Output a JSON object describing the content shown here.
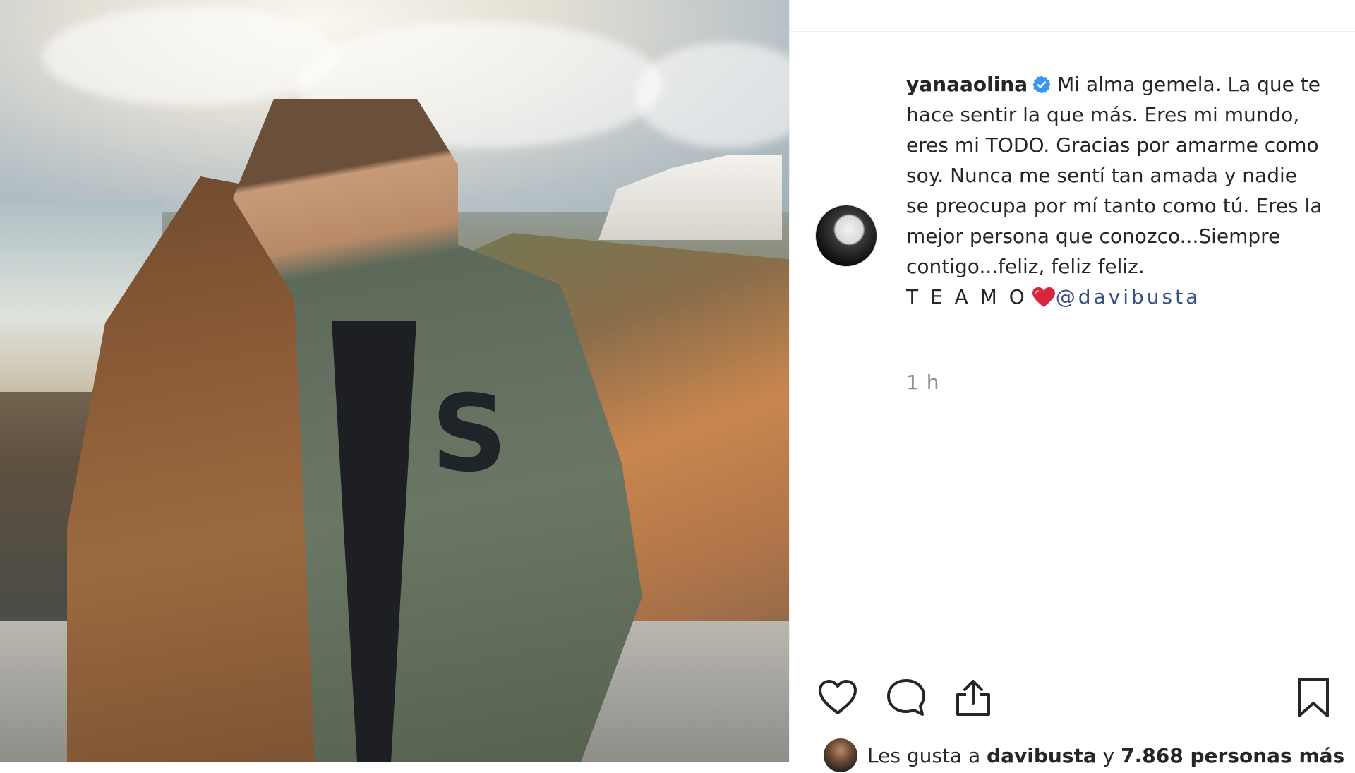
{
  "post": {
    "username": "yanaaolina",
    "caption_text": "Mi alma gemela. La que te hace sentir la que más. Eres mi mundo, eres mi TODO. Gracias por amarme como soy. Nunca me sentí tan amada y nadie se preocupa por mí tanto como tú. Eres la mejor persona que conozco...Siempre contigo...feliz, feliz feliz.",
    "caption_closing": "T E A M O",
    "mention": "@davibusta",
    "timestamp": "1 h",
    "verified_icon": "verified-badge-icon",
    "emoji": "red-heart-emoji"
  },
  "actions": {
    "like_icon": "heart-outline-icon",
    "comment_icon": "comment-bubble-icon",
    "share_icon": "share-upload-icon",
    "save_icon": "bookmark-icon"
  },
  "likes": {
    "prefix": "Les gusta a",
    "liker": "davibusta",
    "connector": "y",
    "count_text": "7.868 personas más"
  },
  "colors": {
    "text": "#262626",
    "muted": "#8e8e8e",
    "link": "#385185",
    "verified": "#3897f0",
    "heart": "#e0245e"
  }
}
